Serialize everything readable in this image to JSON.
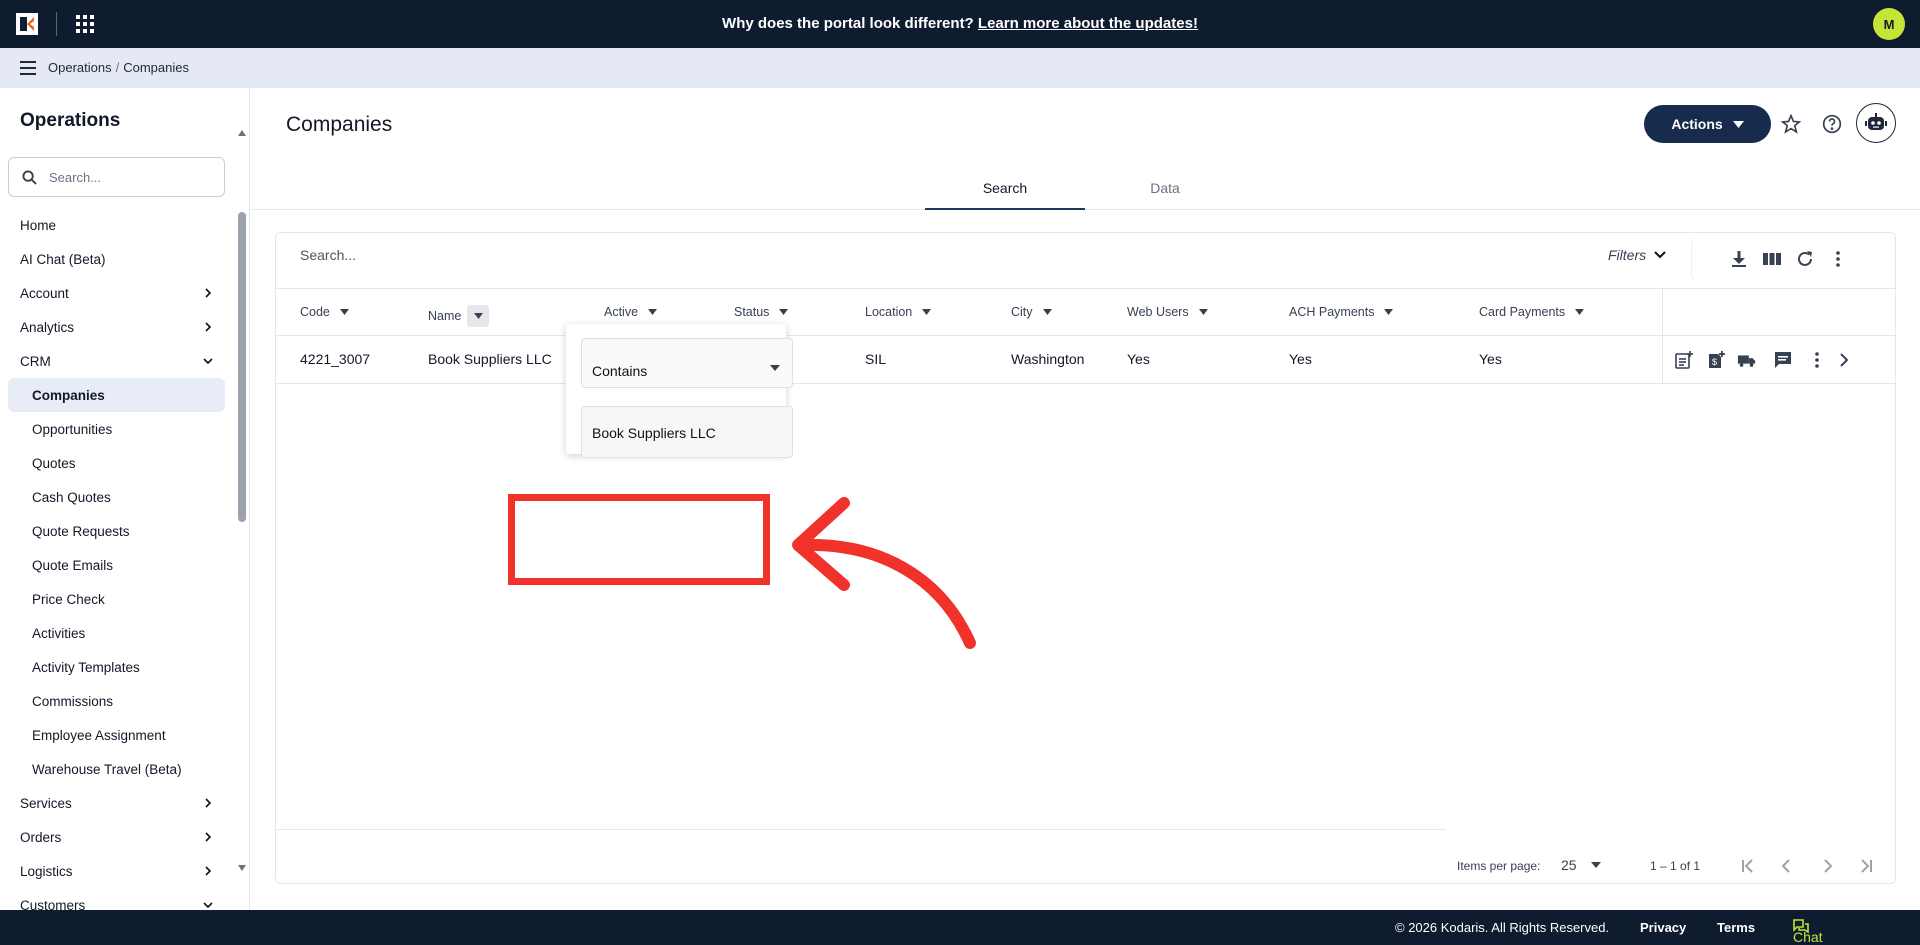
{
  "topbar": {
    "announcement": "Why does the portal look different?",
    "announcement_link": "Learn more about the updates!",
    "avatar_initial": "M"
  },
  "breadcrumb": {
    "parent": "Operations",
    "current": "Companies",
    "separator": "/"
  },
  "sidebar": {
    "title": "Operations",
    "search_placeholder": "Search...",
    "items": [
      {
        "label": "Home"
      },
      {
        "label": "AI Chat (Beta)"
      },
      {
        "label": "Account"
      },
      {
        "label": "Analytics"
      },
      {
        "label": "CRM"
      },
      {
        "label": "Companies"
      },
      {
        "label": "Opportunities"
      },
      {
        "label": "Quotes"
      },
      {
        "label": "Cash Quotes"
      },
      {
        "label": "Quote Requests"
      },
      {
        "label": "Quote Emails"
      },
      {
        "label": "Price Check"
      },
      {
        "label": "Activities"
      },
      {
        "label": "Activity Templates"
      },
      {
        "label": "Commissions"
      },
      {
        "label": "Employee Assignment"
      },
      {
        "label": "Warehouse Travel (Beta)"
      },
      {
        "label": "Services"
      },
      {
        "label": "Orders"
      },
      {
        "label": "Logistics"
      },
      {
        "label": "Customers"
      }
    ]
  },
  "main": {
    "title": "Companies",
    "actions_label": "Actions",
    "tabs": [
      {
        "label": "Search"
      },
      {
        "label": "Data"
      }
    ],
    "search_placeholder": "Search...",
    "filters_label": "Filters",
    "columns": [
      "Code",
      "Name",
      "Active",
      "Status",
      "Location",
      "City",
      "Web Users",
      "ACH Payments",
      "Card Payments"
    ],
    "row": {
      "code": "4221_3007",
      "name": "Book Suppliers LLC",
      "location": "SIL",
      "city": "Washington",
      "web_users": "Yes",
      "ach_payments": "Yes",
      "card_payments": "Yes"
    },
    "filter_popup": {
      "operator": "Contains",
      "value": "Book Suppliers LLC"
    },
    "pager": {
      "items_per_page_label": "Items per page:",
      "items_per_page": "25",
      "range": "1 – 1 of 1"
    }
  },
  "footer": {
    "copyright": "© 2026 Kodaris. All Rights Reserved.",
    "privacy": "Privacy",
    "terms": "Terms",
    "chat": "Chat with us"
  },
  "colors": {
    "navy": "#0f1b2e",
    "accent": "#c4e538",
    "highlight": "#f0322a"
  }
}
